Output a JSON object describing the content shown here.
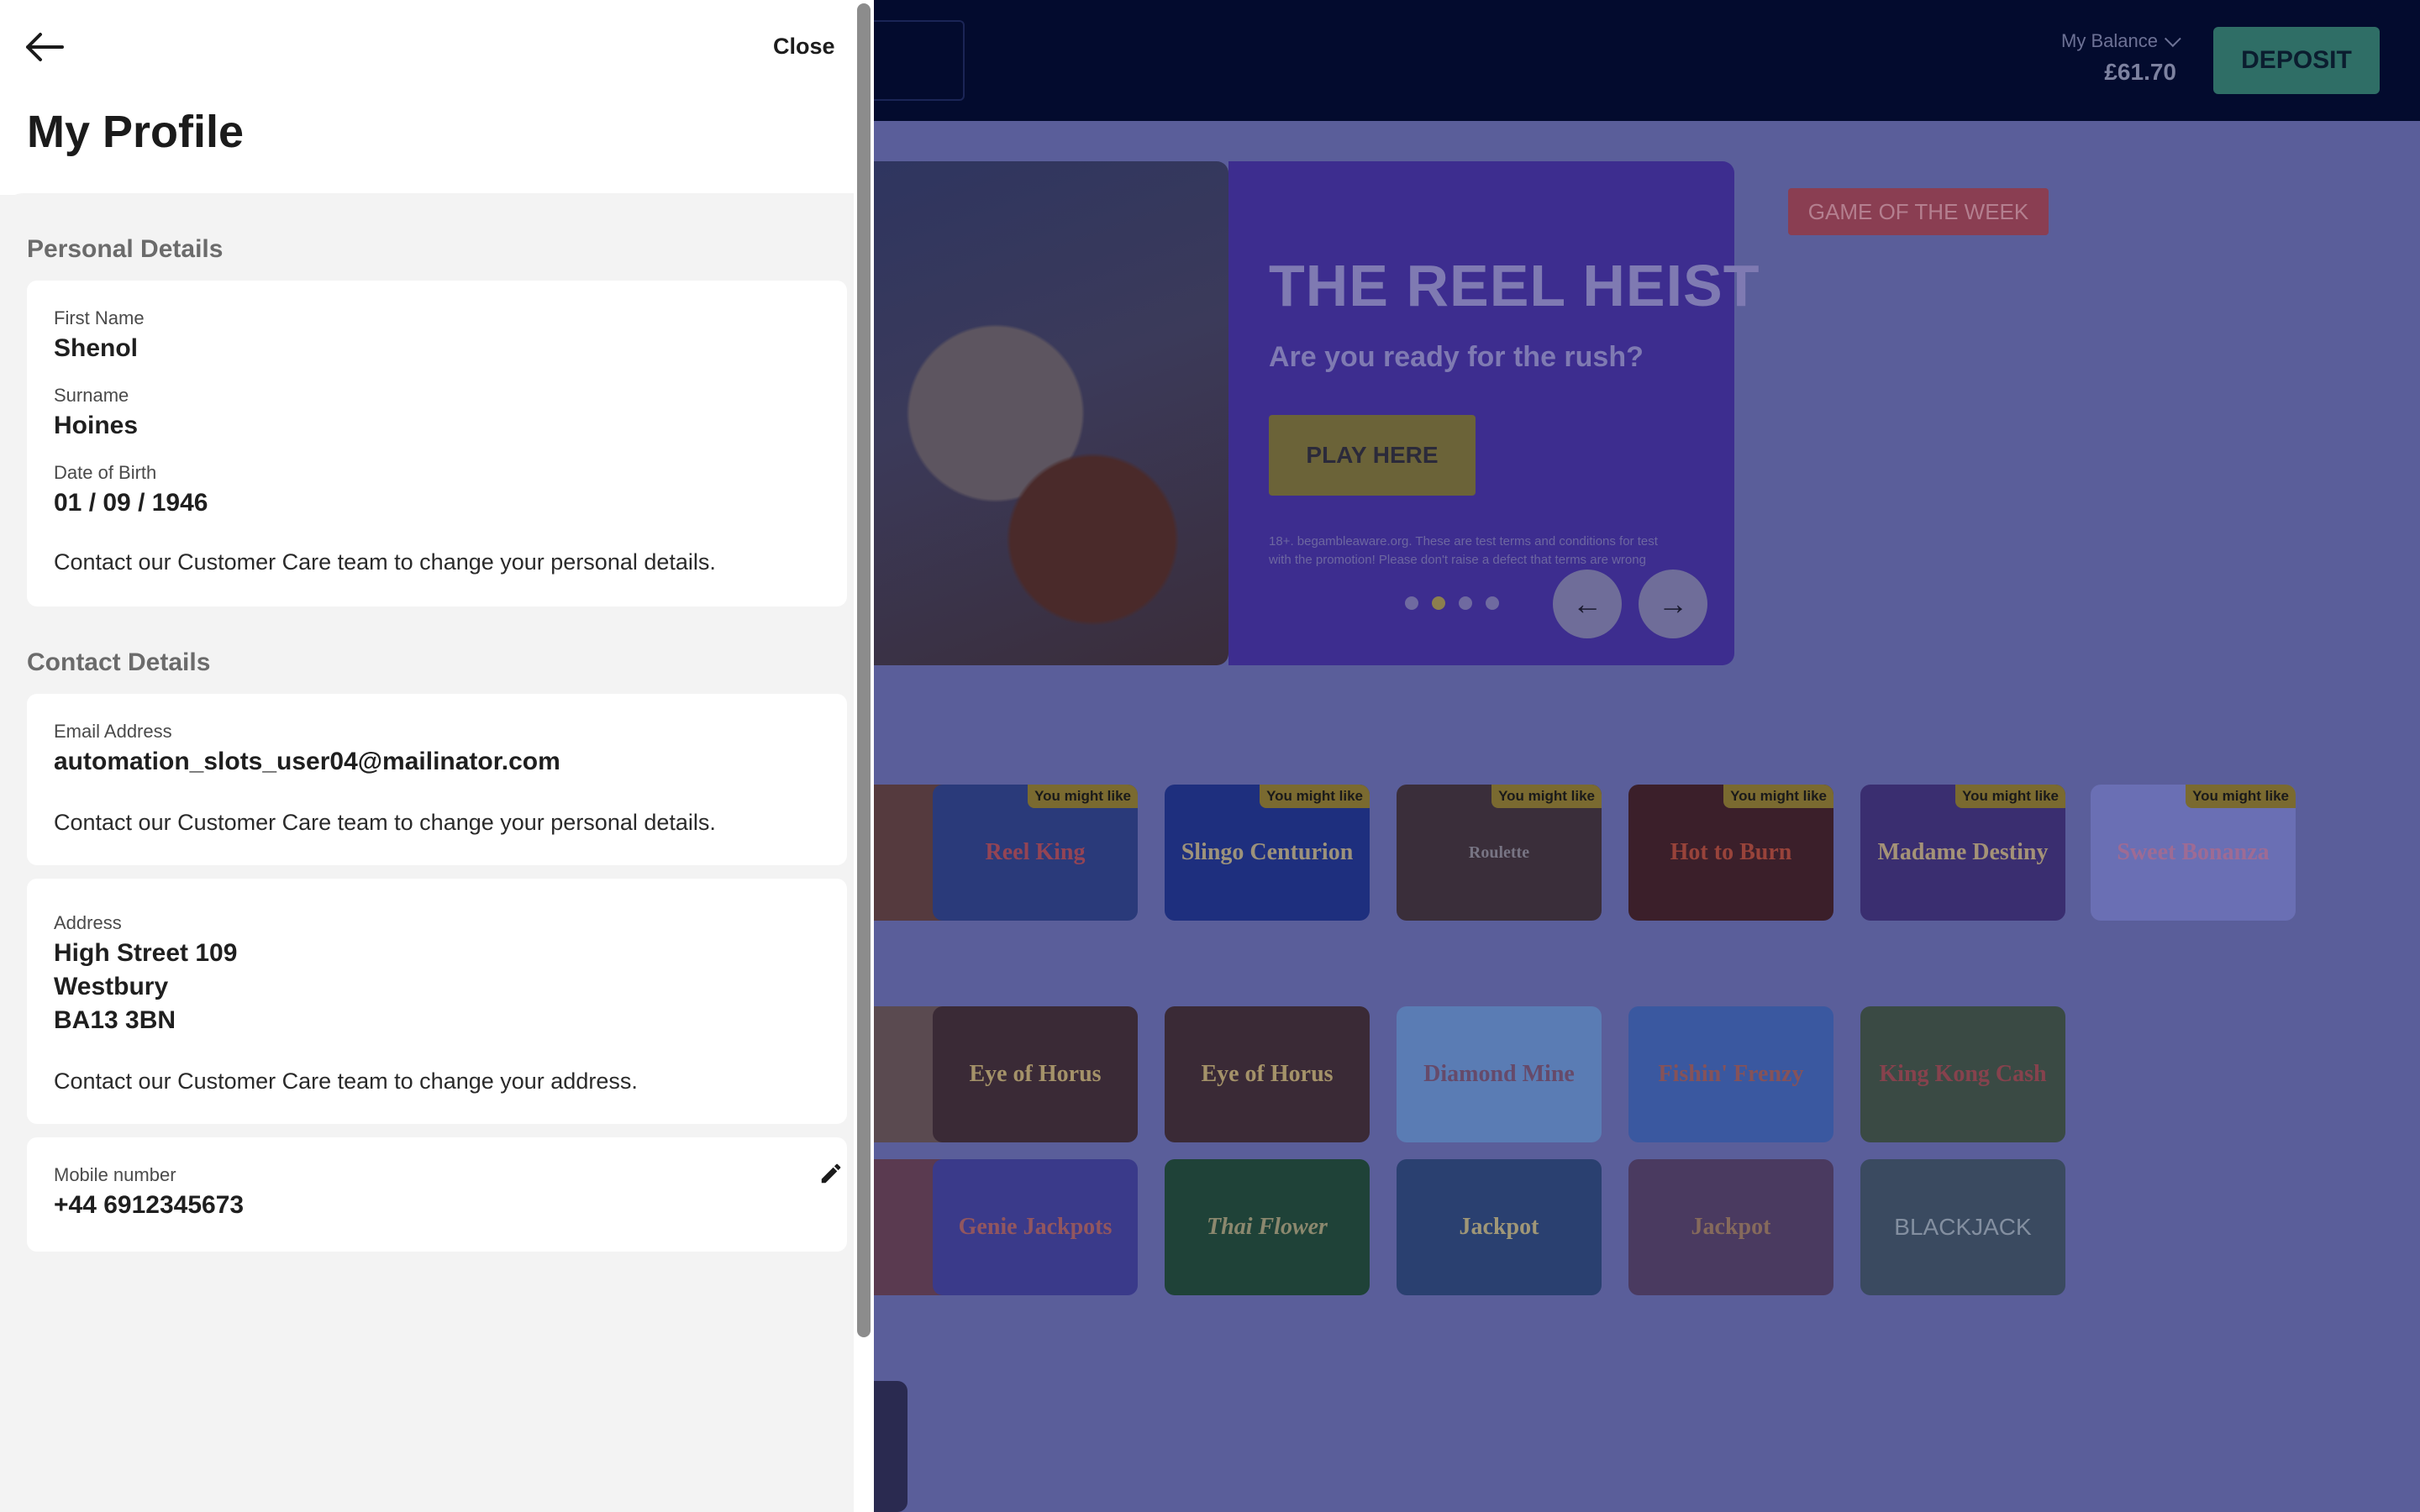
{
  "header": {
    "balance_label": "My Balance",
    "balance_value": "£61.70",
    "deposit_label": "DEPOSIT"
  },
  "hero": {
    "title": "THE REEL HEIST",
    "subtitle": "Are you ready for the rush?",
    "cta": "PLAY HERE",
    "terms_line1": "18+. begambleaware.org. These are test terms and conditions for test",
    "terms_line2": "with the promotion! Please don't raise a defect that terms are wrong",
    "prev_icon": "←",
    "next_icon": "→",
    "active_slide": 2,
    "slide_count": 4
  },
  "badge": {
    "game_of_week": "GAME OF THE WEEK"
  },
  "tiles_row1": [
    {
      "name": "Reel King",
      "tag": "You might like"
    },
    {
      "name": "Slingo Centurion",
      "tag": "You might like"
    },
    {
      "name": "Roulette",
      "tag": "You might like"
    },
    {
      "name": "Hot to Burn",
      "tag": "You might like"
    },
    {
      "name": "Madame Destiny",
      "tag": "You might like"
    },
    {
      "name": "Sweet Bonanza",
      "tag": "You might like"
    }
  ],
  "tiles_row2": [
    {
      "name": "Eye of Horus"
    },
    {
      "name": "Eye of Horus"
    },
    {
      "name": "Diamond Mine"
    },
    {
      "name": "Fishin' Frenzy"
    },
    {
      "name": "King Kong Cash"
    }
  ],
  "tiles_row3": [
    {
      "name": "Genie Jackpots"
    },
    {
      "name": "Thai Flower"
    },
    {
      "name": "Jackpot"
    },
    {
      "name": "Jackpot"
    },
    {
      "name": "BLACKJACK"
    }
  ],
  "panel": {
    "close_label": "Close",
    "title": "My Profile",
    "personal": {
      "section_title": "Personal Details",
      "first_name_label": "First Name",
      "first_name": "Shenol",
      "surname_label": "Surname",
      "surname": "Hoines",
      "dob_label": "Date of Birth",
      "dob": "01 / 09 / 1946",
      "note": "Contact our Customer Care team to change your personal details."
    },
    "contact": {
      "section_title": "Contact Details",
      "email_label": "Email Address",
      "email": "automation_slots_user04@mailinator.com",
      "email_note": "Contact our Customer Care team to change your personal details.",
      "address_label": "Address",
      "address_line1": "High Street 109",
      "address_line2": "Westbury",
      "address_line3": "BA13 3BN",
      "address_note": "Contact our Customer Care team to change your address.",
      "mobile_label": "Mobile number",
      "mobile": "+44 6912345673"
    }
  }
}
